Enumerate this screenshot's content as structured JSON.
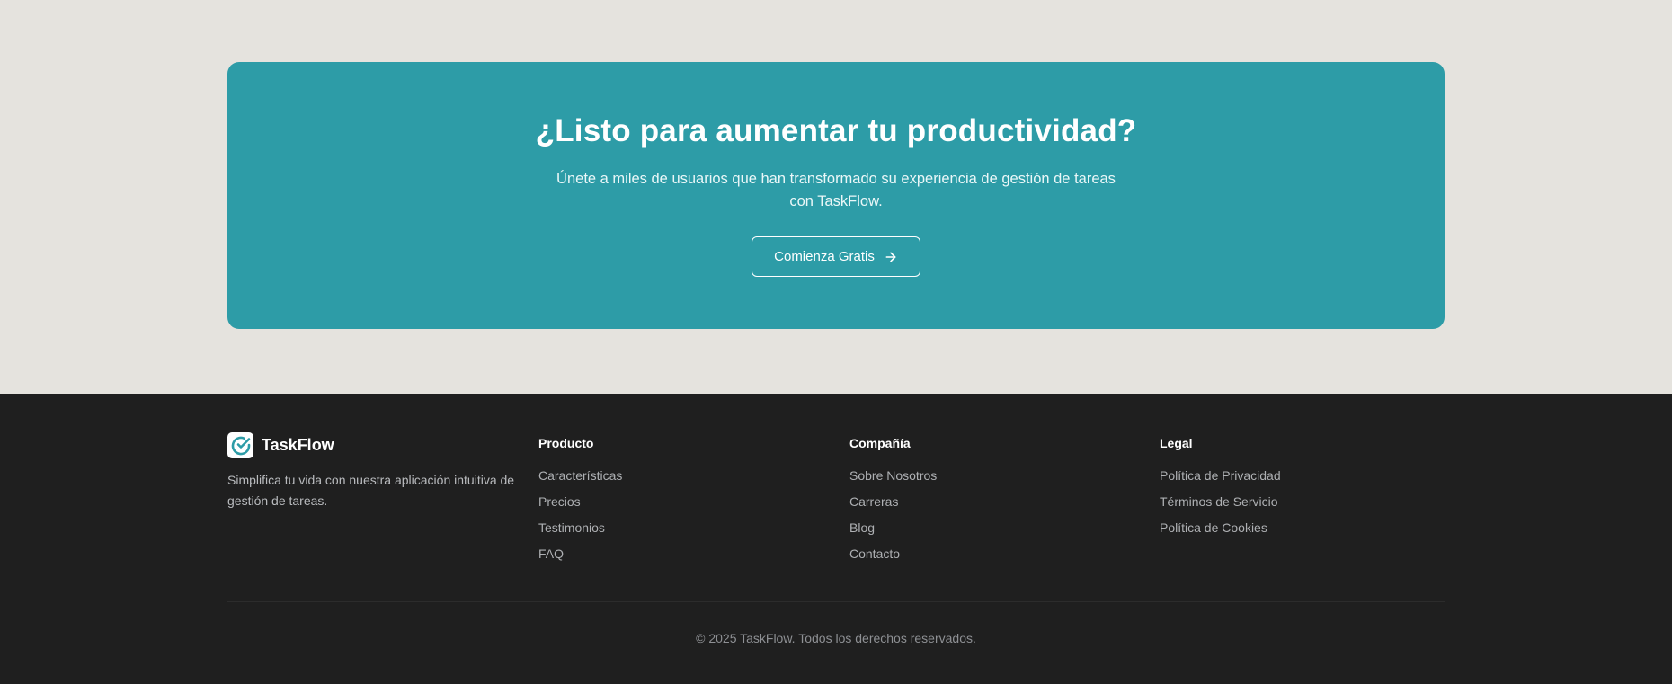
{
  "cta": {
    "title": "¿Listo para aumentar tu productividad?",
    "subtitle": "Únete a miles de usuarios que han transformado su experiencia de gestión de tareas con TaskFlow.",
    "button_label": "Comienza Gratis",
    "button_icon": "arrow-right-icon",
    "background_color": "#2d9ca7"
  },
  "footer": {
    "brand": {
      "name": "TaskFlow",
      "logo_icon": "check-circle-icon",
      "description": "Simplifica tu vida con nuestra aplicación intuitiva de gestión de tareas."
    },
    "columns": [
      {
        "title": "Producto",
        "links": [
          "Características",
          "Precios",
          "Testimonios",
          "FAQ"
        ]
      },
      {
        "title": "Compañía",
        "links": [
          "Sobre Nosotros",
          "Carreras",
          "Blog",
          "Contacto"
        ]
      },
      {
        "title": "Legal",
        "links": [
          "Política de Privacidad",
          "Términos de Servicio",
          "Política de Cookies"
        ]
      }
    ],
    "copyright": "© 2025 TaskFlow. Todos los derechos reservados.",
    "background_color": "#1f1f1f"
  },
  "page_background": "#e5e3de"
}
